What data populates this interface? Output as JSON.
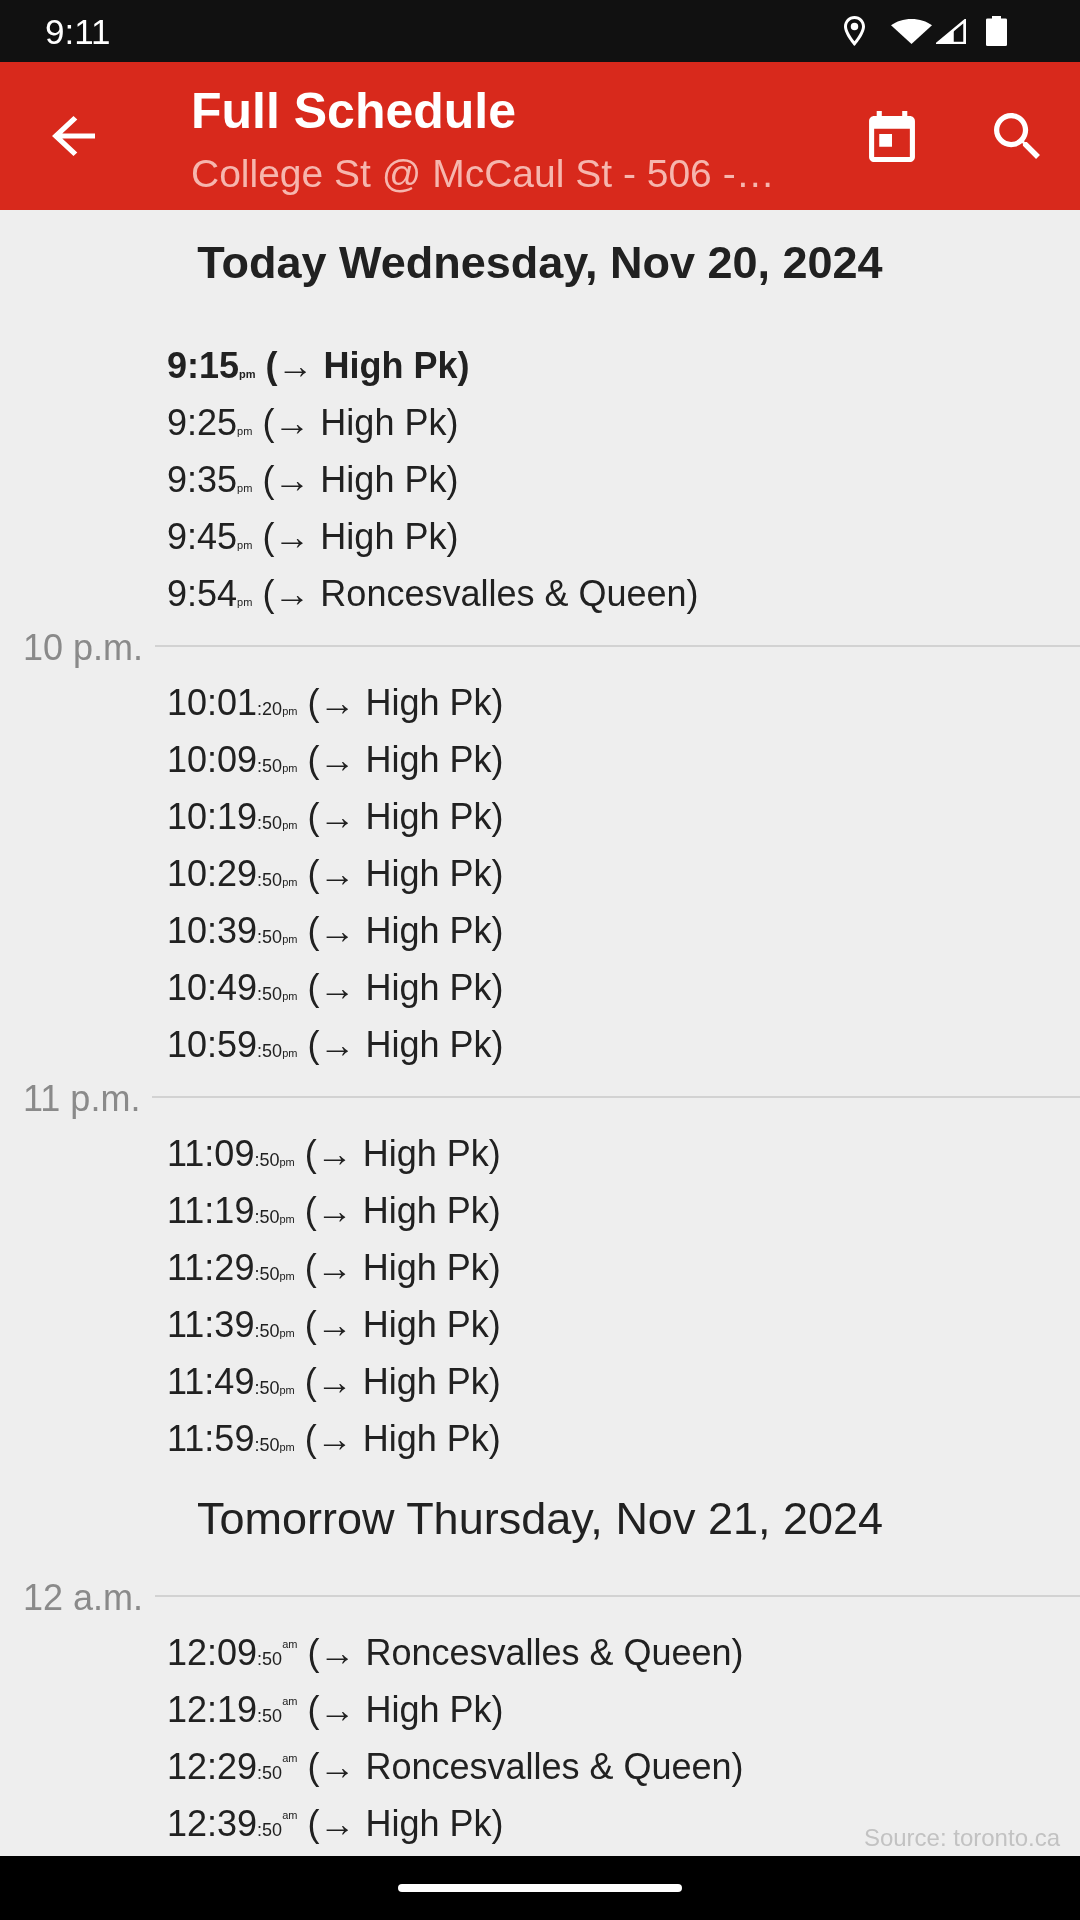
{
  "status_bar": {
    "time": "9:11"
  },
  "app_bar": {
    "title": "Full Schedule",
    "subtitle": "College St @ McCaul St - 506 -…"
  },
  "days": [
    {
      "heading": "Today Wednesday, Nov 20, 2024",
      "current": true,
      "hours": [
        {
          "departures": [
            {
              "time": "9:15",
              "meridiem": "pm",
              "destination": "(→ High Pk)",
              "highlighted": true
            },
            {
              "time": "9:25",
              "meridiem": "pm",
              "destination": "(→ High Pk)",
              "highlighted": false
            },
            {
              "time": "9:35",
              "meridiem": "pm",
              "destination": "(→ High Pk)",
              "highlighted": false
            },
            {
              "time": "9:45",
              "meridiem": "pm",
              "destination": "(→ High Pk)",
              "highlighted": false
            },
            {
              "time": "9:54",
              "meridiem": "pm",
              "destination": "(→ Roncesvalles & Queen)",
              "highlighted": false
            }
          ]
        },
        {
          "label": "10 p.m.",
          "departures": [
            {
              "time": "10:01",
              "seconds": ":20",
              "meridiem": "pm",
              "destination": "(→ High Pk)",
              "highlighted": false
            },
            {
              "time": "10:09",
              "seconds": ":50",
              "meridiem": "pm",
              "destination": "(→ High Pk)",
              "highlighted": false
            },
            {
              "time": "10:19",
              "seconds": ":50",
              "meridiem": "pm",
              "destination": "(→ High Pk)",
              "highlighted": false
            },
            {
              "time": "10:29",
              "seconds": ":50",
              "meridiem": "pm",
              "destination": "(→ High Pk)",
              "highlighted": false
            },
            {
              "time": "10:39",
              "seconds": ":50",
              "meridiem": "pm",
              "destination": "(→ High Pk)",
              "highlighted": false
            },
            {
              "time": "10:49",
              "seconds": ":50",
              "meridiem": "pm",
              "destination": "(→ High Pk)",
              "highlighted": false
            },
            {
              "time": "10:59",
              "seconds": ":50",
              "meridiem": "pm",
              "destination": "(→ High Pk)",
              "highlighted": false
            }
          ]
        },
        {
          "label": "11 p.m.",
          "departures": [
            {
              "time": "11:09",
              "seconds": ":50",
              "meridiem": "pm",
              "destination": "(→ High Pk)",
              "highlighted": false
            },
            {
              "time": "11:19",
              "seconds": ":50",
              "meridiem": "pm",
              "destination": "(→ High Pk)",
              "highlighted": false
            },
            {
              "time": "11:29",
              "seconds": ":50",
              "meridiem": "pm",
              "destination": "(→ High Pk)",
              "highlighted": false
            },
            {
              "time": "11:39",
              "seconds": ":50",
              "meridiem": "pm",
              "destination": "(→ High Pk)",
              "highlighted": false
            },
            {
              "time": "11:49",
              "seconds": ":50",
              "meridiem": "pm",
              "destination": "(→ High Pk)",
              "highlighted": false
            },
            {
              "time": "11:59",
              "seconds": ":50",
              "meridiem": "pm",
              "destination": "(→ High Pk)",
              "highlighted": false
            }
          ]
        }
      ]
    },
    {
      "heading": "Tomorrow Thursday, Nov 21, 2024",
      "current": false,
      "hours": [
        {
          "label": "12 a.m.",
          "departures": [
            {
              "time": "12:09",
              "seconds": ":50",
              "meridiem": "$^{am}$",
              "destination": "(→ Roncesvalles & Queen)",
              "highlighted": false
            },
            {
              "time": "12:19",
              "seconds": ":50",
              "meridiem": "$^{am}$",
              "destination": "(→ High Pk)",
              "highlighted": false
            },
            {
              "time": "12:29",
              "seconds": ":50",
              "meridiem": "$^{am}$",
              "destination": "(→ Roncesvalles & Queen)",
              "highlighted": false
            },
            {
              "time": "12:39",
              "seconds": ":50",
              "meridiem": "$^{am}$",
              "destination": "(→ High Pk)",
              "highlighted": false
            }
          ]
        }
      ]
    }
  ],
  "source": "Source: toronto.ca"
}
